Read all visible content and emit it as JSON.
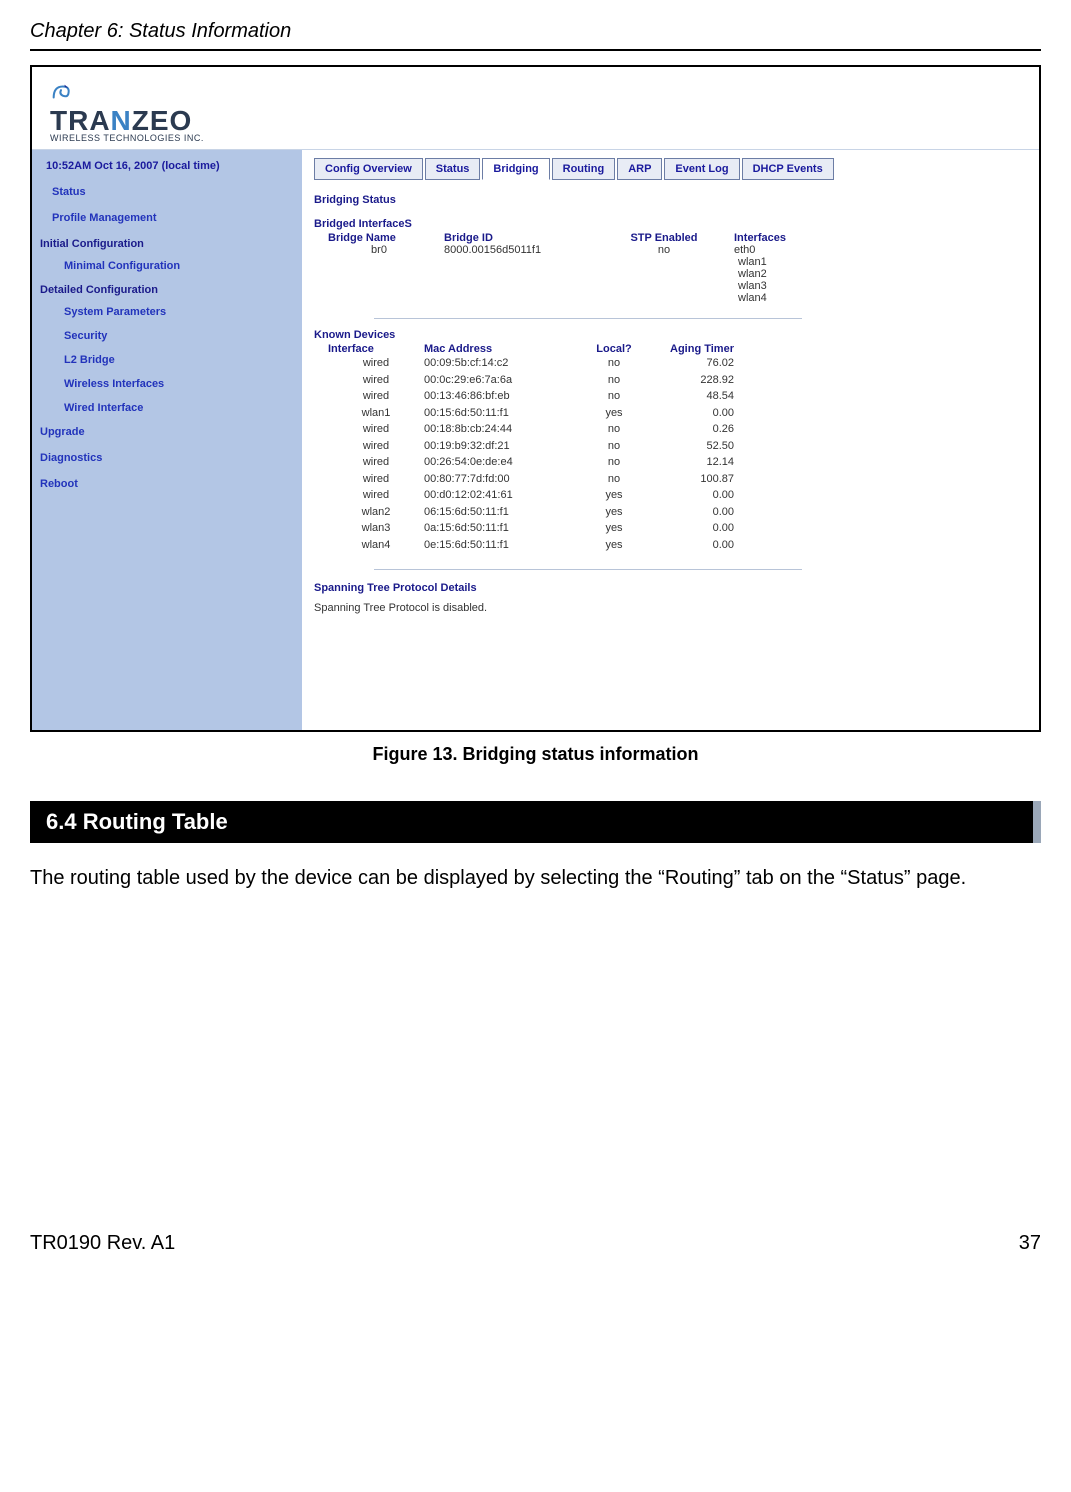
{
  "page": {
    "chapter_header": "Chapter 6: Status Information",
    "footer_left": "TR0190 Rev. A1",
    "footer_right": "37",
    "figure_caption": "Figure 13. Bridging status information",
    "section_number_title": "6.4     Routing Table",
    "body_paragraph": "The routing table used by the device can be displayed by selecting the “Routing” tab on the “Status” page."
  },
  "app": {
    "logo_main": "TRANZEO",
    "logo_sub": "WIRELESS  TECHNOLOGIES INC.",
    "sidebar": {
      "time": "10:52AM Oct 16, 2007 (local time)",
      "links_top": [
        "Status",
        "Profile Management"
      ],
      "section_initial": "Initial Configuration",
      "sub_initial": [
        "Minimal Configuration"
      ],
      "section_detailed": "Detailed Configuration",
      "sub_detailed": [
        "System Parameters",
        "Security",
        "L2 Bridge",
        "Wireless Interfaces",
        "Wired Interface"
      ],
      "links_bottom": [
        "Upgrade",
        "Diagnostics",
        "Reboot"
      ]
    },
    "tabs": [
      "Config Overview",
      "Status",
      "Bridging",
      "Routing",
      "ARP",
      "Event Log",
      "DHCP Events"
    ],
    "active_tab_index": 2,
    "bridging": {
      "title": "Bridging Status",
      "subhead": "Bridged InterfaceS",
      "columns": {
        "name": "Bridge Name",
        "id": "Bridge ID",
        "stp": "STP Enabled",
        "ifc": "Interfaces"
      },
      "row": {
        "name": "br0",
        "id": "8000.00156d5011f1",
        "stp": "no",
        "ifc": [
          "eth0",
          "wlan1",
          "wlan2",
          "wlan3",
          "wlan4"
        ]
      }
    },
    "devices": {
      "title": "Known Devices",
      "columns": {
        "iface": "Interface",
        "mac": "Mac Address",
        "local": "Local?",
        "aging": "Aging Timer"
      },
      "rows": [
        {
          "iface": "wired",
          "mac": "00:09:5b:cf:14:c2",
          "local": "no",
          "aging": "76.02"
        },
        {
          "iface": "wired",
          "mac": "00:0c:29:e6:7a:6a",
          "local": "no",
          "aging": "228.92"
        },
        {
          "iface": "wired",
          "mac": "00:13:46:86:bf:eb",
          "local": "no",
          "aging": "48.54"
        },
        {
          "iface": "wlan1",
          "mac": "00:15:6d:50:11:f1",
          "local": "yes",
          "aging": "0.00"
        },
        {
          "iface": "wired",
          "mac": "00:18:8b:cb:24:44",
          "local": "no",
          "aging": "0.26"
        },
        {
          "iface": "wired",
          "mac": "00:19:b9:32:df:21",
          "local": "no",
          "aging": "52.50"
        },
        {
          "iface": "wired",
          "mac": "00:26:54:0e:de:e4",
          "local": "no",
          "aging": "12.14"
        },
        {
          "iface": "wired",
          "mac": "00:80:77:7d:fd:00",
          "local": "no",
          "aging": "100.87"
        },
        {
          "iface": "wired",
          "mac": "00:d0:12:02:41:61",
          "local": "yes",
          "aging": "0.00"
        },
        {
          "iface": "wlan2",
          "mac": "06:15:6d:50:11:f1",
          "local": "yes",
          "aging": "0.00"
        },
        {
          "iface": "wlan3",
          "mac": "0a:15:6d:50:11:f1",
          "local": "yes",
          "aging": "0.00"
        },
        {
          "iface": "wlan4",
          "mac": "0e:15:6d:50:11:f1",
          "local": "yes",
          "aging": "0.00"
        }
      ]
    },
    "stp": {
      "title": "Spanning Tree Protocol Details",
      "text": "Spanning Tree Protocol is disabled."
    }
  }
}
